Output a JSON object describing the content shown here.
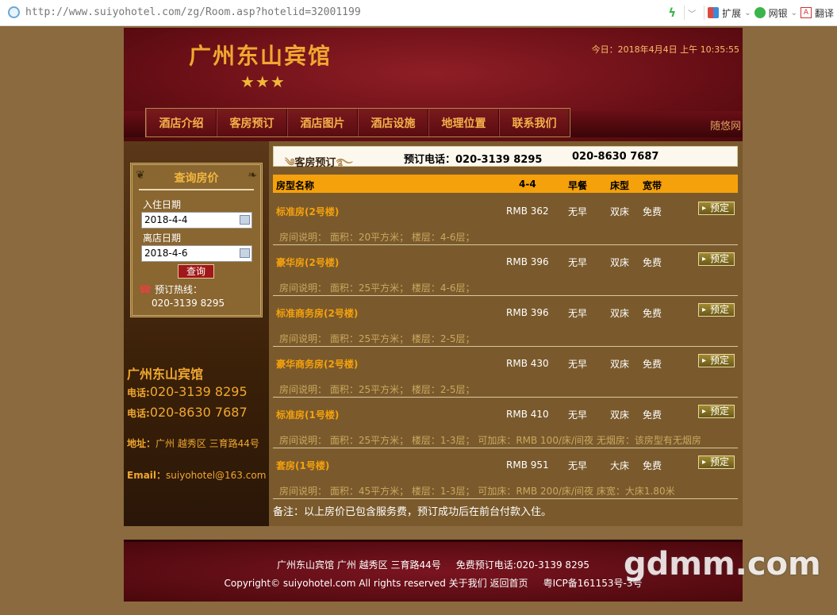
{
  "browser": {
    "url": "http://www.suiyohotel.com/zg/Room.asp?hotelid=32001199",
    "tools": {
      "expand": "扩展",
      "bank": "网银",
      "translate": "翻译"
    }
  },
  "header": {
    "hotel_name": "广州东山宾馆",
    "stars": "★★★",
    "date": "今日：2018年4月4日 上午 10:35:55",
    "brand_link": "随悠网"
  },
  "nav": [
    {
      "label": "酒店介绍"
    },
    {
      "label": "客房预订"
    },
    {
      "label": "酒店图片"
    },
    {
      "label": "酒店设施"
    },
    {
      "label": "地理位置"
    },
    {
      "label": "联系我们"
    }
  ],
  "query": {
    "title": "查询房价",
    "checkin_label": "入住日期",
    "checkin_value": "2018-4-4",
    "checkout_label": "离店日期",
    "checkout_value": "2018-4-6",
    "button": "查询",
    "hotline_label": "预订热线：",
    "hotline_number": "020-3139 8295"
  },
  "contact": {
    "name": "广州东山宾馆",
    "tel_label": "电话:",
    "tel1": "020-3139 8295",
    "tel2": "020-8630 7687",
    "address_label": "地址：",
    "address": "广州 越秀区 三育路44号",
    "email_label": "Email：",
    "email": "suiyohotel@163.com"
  },
  "booking": {
    "title": "客房预订",
    "phone_label": "预订电话：",
    "phone1": "020-3139 8295",
    "phone2": "020-8630 7687"
  },
  "table": {
    "headers": {
      "name": "房型名称",
      "date": "4-4",
      "breakfast": "早餐",
      "bed": "床型",
      "broadband": "宽带"
    },
    "book_label": "预定",
    "rooms": [
      {
        "name": "标准房(2号楼)",
        "price": "RMB 362",
        "breakfast": "无早",
        "bed": "双床",
        "broadband": "免费",
        "desc": "房间说明： 面积：20平方米； 楼层：4-6层；"
      },
      {
        "name": "豪华房(2号楼)",
        "price": "RMB 396",
        "breakfast": "无早",
        "bed": "双床",
        "broadband": "免费",
        "desc": "房间说明： 面积：25平方米； 楼层：4-6层；"
      },
      {
        "name": "标准商务房(2号楼)",
        "price": "RMB 396",
        "breakfast": "无早",
        "bed": "双床",
        "broadband": "免费",
        "desc": "房间说明： 面积：25平方米； 楼层：2-5层；"
      },
      {
        "name": "豪华商务房(2号楼)",
        "price": "RMB 430",
        "breakfast": "无早",
        "bed": "双床",
        "broadband": "免费",
        "desc": "房间说明： 面积：25平方米； 楼层：2-5层；"
      },
      {
        "name": "标准房(1号楼)",
        "price": "RMB 410",
        "breakfast": "无早",
        "bed": "双床",
        "broadband": "免费",
        "desc": "房间说明： 面积：25平方米； 楼层：1-3层； 可加床：RMB 100/床/间夜 无烟房：该房型有无烟房"
      },
      {
        "name": "套房(1号楼)",
        "price": "RMB 951",
        "breakfast": "无早",
        "bed": "大床",
        "broadband": "免费",
        "desc": "房间说明： 面积：45平方米； 楼层：1-3层； 可加床：RMB 200/床/间夜 床宽：大床1.80米"
      }
    ],
    "note": "备注：以上房价已包含服务费，预订成功后在前台付款入住。"
  },
  "footer": {
    "line1": "广州东山宾馆 广州 越秀区 三育路44号     免费预订电话:020-3139 8295",
    "line2": "Copyright© suiyohotel.com All rights reserved 关于我们 返回首页     粤ICP备161153号-3号"
  },
  "watermark": "gdmm.com"
}
